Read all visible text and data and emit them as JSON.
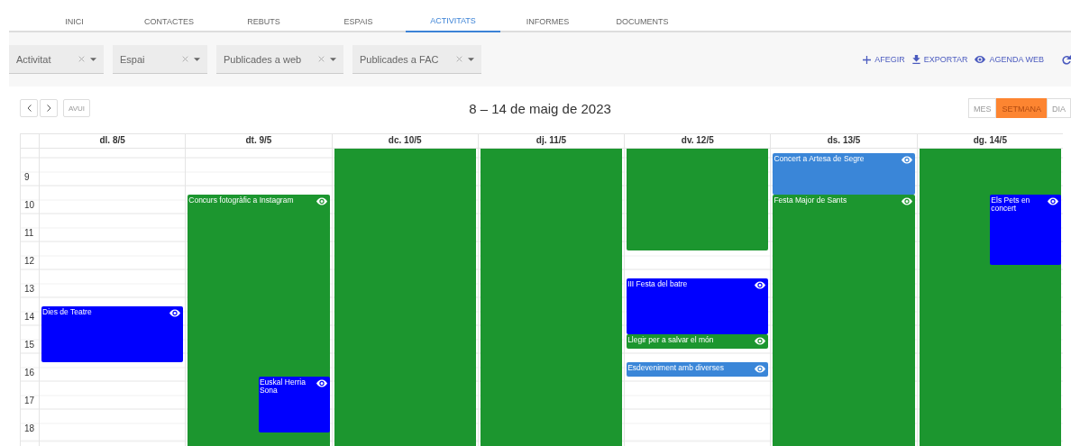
{
  "tabs": [
    {
      "label": "INICI",
      "selected": false
    },
    {
      "label": "CONTACTES",
      "selected": false
    },
    {
      "label": "REBUTS",
      "selected": false
    },
    {
      "label": "ESPAIS",
      "selected": false
    },
    {
      "label": "ACTIVITATS",
      "selected": true
    },
    {
      "label": "INFORMES",
      "selected": false
    },
    {
      "label": "DOCUMENTS",
      "selected": false
    }
  ],
  "filters": [
    {
      "label": "Activitat"
    },
    {
      "label": "Espai"
    },
    {
      "label": "Publicades a web"
    },
    {
      "label": "Publicades a FAC"
    }
  ],
  "actions": [
    {
      "kind": "add",
      "label": "AFEGIR"
    },
    {
      "kind": "export",
      "label": "EXPORTAR"
    },
    {
      "kind": "web",
      "label": "AGENDA WEB"
    },
    {
      "kind": "refresh"
    }
  ],
  "calendar": {
    "today_button": "AVUI",
    "title": "8 – 14 de maig de 2023",
    "views": [
      {
        "label": "MES",
        "selected": false
      },
      {
        "label": "SETMANA",
        "selected": true
      },
      {
        "label": "DIA",
        "selected": false
      }
    ],
    "hours": [
      "9",
      "10",
      "11",
      "12",
      "13",
      "14",
      "15",
      "16",
      "17",
      "18"
    ],
    "days": [
      {
        "header": "dl. 8/5",
        "events": [
          {
            "title": "Dies de Teatre",
            "color": "#0000ff",
            "web": true
          }
        ]
      },
      {
        "header": "dt. 9/5",
        "events": [
          {
            "title": "Concurs fotogràfic a Instagram",
            "color": "#1c962f",
            "web": true
          },
          {
            "title": "Euskal Herria Sona",
            "color": "#0000ff",
            "web": true
          }
        ]
      },
      {
        "header": "dc. 10/5",
        "events": [
          {
            "color": "#1c962f",
            "web": false
          }
        ]
      },
      {
        "header": "dj. 11/5",
        "events": [
          {
            "color": "#1c962f",
            "web": false
          }
        ]
      },
      {
        "header": "dv. 12/5",
        "events": [
          {
            "color": "#1c962f",
            "web": false
          },
          {
            "title": "III Festa del batre",
            "color": "#0000ff",
            "web": true
          },
          {
            "title": "Llegir per a salvar el món",
            "color": "#1c962f",
            "web": true
          },
          {
            "title": "Esdeveniment amb diverses",
            "color": "#3a86d8",
            "web": true
          }
        ]
      },
      {
        "header": "ds. 13/5",
        "events": [
          {
            "title": "Concert a Artesa de Segre",
            "color": "#3a86d8",
            "web": true
          },
          {
            "title": "Festa Major de Sants",
            "color": "#1c962f",
            "web": true
          }
        ]
      },
      {
        "header": "dg. 14/5",
        "events": [
          {
            "color": "#1c962f",
            "web": false
          },
          {
            "title": "Els Pets en concert",
            "color": "#0000ff",
            "web": true
          }
        ]
      }
    ]
  }
}
